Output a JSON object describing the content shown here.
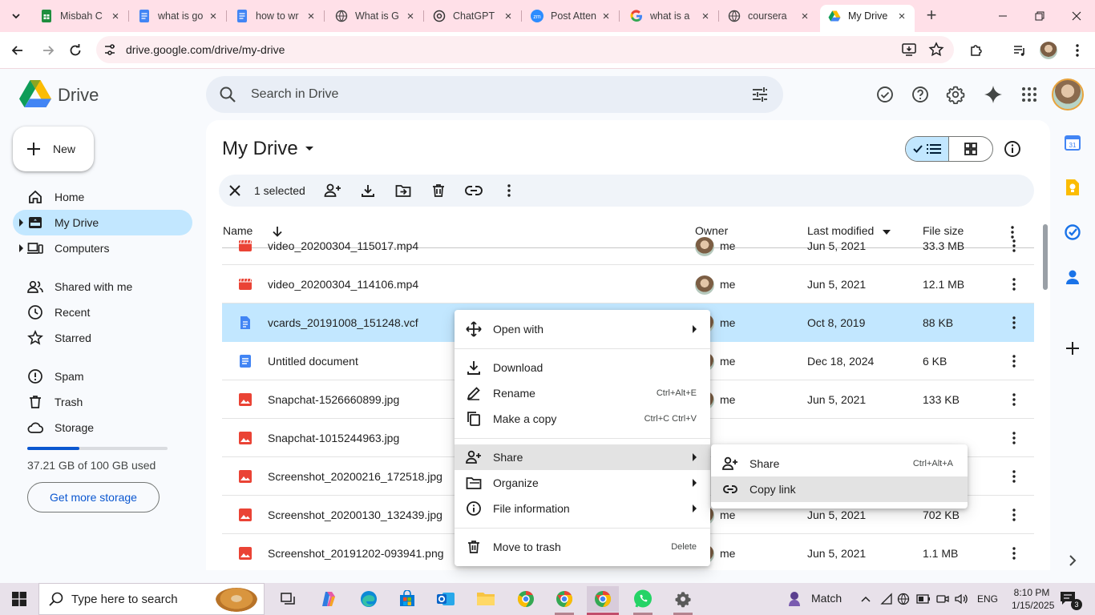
{
  "browser": {
    "tabs": [
      {
        "label": "Misbah C",
        "favicon": "sheets-icon",
        "active": false
      },
      {
        "label": "what is go",
        "favicon": "docs-icon",
        "active": false
      },
      {
        "label": "how to wr",
        "favicon": "docs-icon",
        "active": false
      },
      {
        "label": "What is G",
        "favicon": "globe-icon",
        "active": false
      },
      {
        "label": "ChatGPT",
        "favicon": "chatgpt-icon",
        "active": false
      },
      {
        "label": "Post Atten",
        "favicon": "zoom-icon",
        "active": false
      },
      {
        "label": "what is a",
        "favicon": "google-icon",
        "active": false
      },
      {
        "label": "coursera",
        "favicon": "globe-icon",
        "active": false
      },
      {
        "label": "My Drive",
        "favicon": "drive-icon",
        "active": true
      }
    ],
    "url": "drive.google.com/drive/my-drive"
  },
  "header": {
    "app_name": "Drive",
    "search_placeholder": "Search in Drive"
  },
  "sidebar": {
    "new_label": "New",
    "items": [
      {
        "label": "Home",
        "icon": "home-icon"
      },
      {
        "label": "My Drive",
        "icon": "my-drive-icon",
        "active": true
      },
      {
        "label": "Computers",
        "icon": "computers-icon"
      },
      {
        "label": "Shared with me",
        "icon": "shared-icon"
      },
      {
        "label": "Recent",
        "icon": "clock-icon"
      },
      {
        "label": "Starred",
        "icon": "star-icon"
      },
      {
        "label": "Spam",
        "icon": "spam-icon"
      },
      {
        "label": "Trash",
        "icon": "trash-icon"
      },
      {
        "label": "Storage",
        "icon": "cloud-icon"
      }
    ],
    "storage_text": "37.21 GB of 100 GB used",
    "storage_used_fraction": 0.3721,
    "get_storage_label": "Get more storage"
  },
  "main": {
    "title": "My Drive",
    "selection": {
      "count_label": "1 selected"
    },
    "columns": {
      "name": "Name",
      "owner": "Owner",
      "modified": "Last modified",
      "size": "File size"
    },
    "files": [
      {
        "name": "video_20200304_115017.mp4",
        "type": "video",
        "owner": "me",
        "modified": "Jun 5, 2021",
        "size": "33.3 MB"
      },
      {
        "name": "video_20200304_114106.mp4",
        "type": "video",
        "owner": "me",
        "modified": "Jun 5, 2021",
        "size": "12.1 MB"
      },
      {
        "name": "vcards_20191008_151248.vcf",
        "type": "doc",
        "owner": "me",
        "modified": "Oct 8, 2019",
        "size": "88 KB",
        "selected": true
      },
      {
        "name": "Untitled document",
        "type": "gdoc",
        "owner": "me",
        "modified": "Dec 18, 2024",
        "size": "6 KB"
      },
      {
        "name": "Snapchat-1526660899.jpg",
        "type": "image",
        "owner": "me",
        "modified": "Jun 5, 2021",
        "size": "133 KB"
      },
      {
        "name": "Snapchat-1015244963.jpg",
        "type": "image",
        "owner": "",
        "modified": "",
        "size": ""
      },
      {
        "name": "Screenshot_20200216_172518.jpg",
        "type": "image",
        "owner": "",
        "modified": "",
        "size": ""
      },
      {
        "name": "Screenshot_20200130_132439.jpg",
        "type": "image",
        "owner": "me",
        "modified": "Jun 5, 2021",
        "size": "702 KB"
      },
      {
        "name": "Screenshot_20191202-093941.png",
        "type": "image",
        "owner": "me",
        "modified": "Jun 5, 2021",
        "size": "1.1 MB"
      }
    ]
  },
  "context_menu": {
    "items": [
      {
        "label": "Open with",
        "icon": "open-with-icon",
        "shortcut": "",
        "submenu": true
      },
      {
        "label": "Download",
        "icon": "download-icon",
        "shortcut": "",
        "submenu": false
      },
      {
        "label": "Rename",
        "icon": "rename-icon",
        "shortcut": "Ctrl+Alt+E",
        "submenu": false
      },
      {
        "label": "Make a copy",
        "icon": "copy-icon",
        "shortcut": "Ctrl+C Ctrl+V",
        "submenu": false
      },
      {
        "label": "Share",
        "icon": "share-icon",
        "shortcut": "",
        "submenu": true,
        "highlighted": true
      },
      {
        "label": "Organize",
        "icon": "organize-icon",
        "shortcut": "",
        "submenu": true
      },
      {
        "label": "File information",
        "icon": "info-icon",
        "shortcut": "",
        "submenu": true
      },
      {
        "label": "Move to trash",
        "icon": "trash-icon",
        "shortcut": "Delete",
        "submenu": false
      }
    ],
    "share_submenu": [
      {
        "label": "Share",
        "icon": "share-icon",
        "shortcut": "Ctrl+Alt+A"
      },
      {
        "label": "Copy link",
        "icon": "link-icon",
        "shortcut": "",
        "highlighted": true
      }
    ]
  },
  "taskbar": {
    "search_placeholder": "Type here to search",
    "weather_label": "Match",
    "language": "ENG",
    "time": "8:10 PM",
    "date": "1/15/2025",
    "notification_count": "3"
  },
  "colors": {
    "accent": "#0b57d0",
    "selected_row": "#c2e7ff",
    "tabstrip": "#ffe0e8",
    "menu_highlight": "#e3e3e3"
  }
}
